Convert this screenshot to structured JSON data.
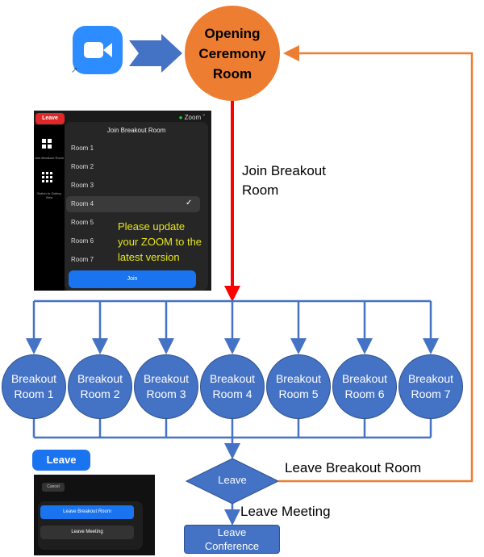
{
  "colors": {
    "zoom_blue": "#2D8CFF",
    "flow_blue": "#4472C4",
    "orange": "#ED7D31",
    "red": "#FF0000",
    "note_yellow": "#E6E620"
  },
  "start": {
    "icon": "zoom-app-icon"
  },
  "opening": {
    "label_lines": [
      "Opening",
      "Ceremony",
      "Room"
    ]
  },
  "join_label": [
    "Join Breakout",
    "Room"
  ],
  "zoom_panel": {
    "leave": "Leave",
    "app_name": "Zoom",
    "title": "Join Breakout Room",
    "side_items": [
      {
        "label": "Join Breakout Room",
        "icon": "grid-4-icon"
      },
      {
        "label": "Switch to Gallery View",
        "icon": "grid-9-icon"
      }
    ],
    "rooms": [
      "Room 1",
      "Room 2",
      "Room 3",
      "Room 4",
      "Room 5",
      "Room 6",
      "Room 7"
    ],
    "selected_room": "Room 4",
    "join_button": "Join",
    "note": [
      "Please update",
      "your ZOOM to the",
      "latest version"
    ]
  },
  "breakout_rooms": [
    [
      "Breakout",
      "Room 1"
    ],
    [
      "Breakout",
      "Room 2"
    ],
    [
      "Breakout",
      "Room 3"
    ],
    [
      "Breakout",
      "Room 4"
    ],
    [
      "Breakout",
      "Room 5"
    ],
    [
      "Breakout",
      "Room 6"
    ],
    [
      "Breakout",
      "Room 7"
    ]
  ],
  "leave_panel": {
    "leave_button": "Leave",
    "cancel": "Cancel",
    "leave_breakout": "Leave Breakout Room",
    "leave_meeting": "Leave Meeting"
  },
  "decision": {
    "label": "Leave"
  },
  "leave_breakout_label": "Leave Breakout Room",
  "leave_meeting_label": "Leave Meeting",
  "end": {
    "label_lines": [
      "Leave",
      "Conference"
    ]
  }
}
